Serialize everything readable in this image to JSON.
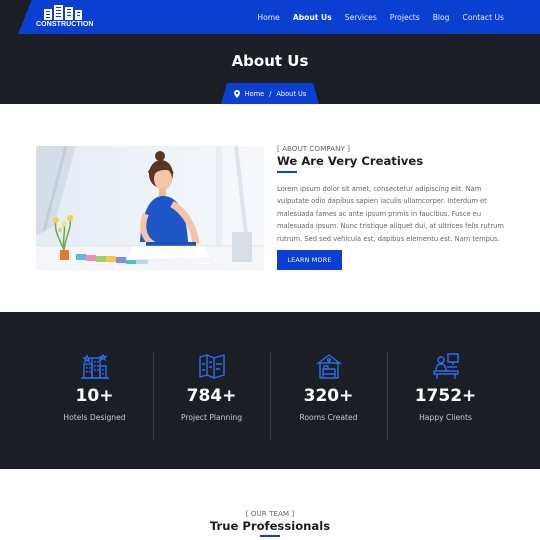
{
  "brand": {
    "name": "CONSTRUCTION"
  },
  "nav": {
    "items": [
      {
        "label": "Home"
      },
      {
        "label": "About Us"
      },
      {
        "label": "Services"
      },
      {
        "label": "Projects"
      },
      {
        "label": "Blog"
      },
      {
        "label": "Contact Us"
      }
    ],
    "active_index": 1
  },
  "banner": {
    "title": "About Us",
    "breadcrumb": {
      "home": "Home",
      "separator": "/",
      "current": "About Us"
    }
  },
  "about": {
    "kicker": "[ ABOUT COMPANY ]",
    "title": "We Are Very Creatives",
    "body": "Lorem ipsum dolor sit amet, consectetur adipiscing elit. Nam vulputate odio dapibus sapien iaculis ullamcorper. Interdum et malesuada fames ac ante ipsum primis in faucibus. Fusce eu malesuada ipsum. Nunc tristique aliquet dui, at ultrices felis rutrum rutrum. Sed sed vehicula est, dapibus elementu est. Nam tempus.",
    "button": "LEARN MORE"
  },
  "stats": [
    {
      "value": "10+",
      "label": "Hotels Designed",
      "icon": "city-buildings-icon"
    },
    {
      "value": "784+",
      "label": "Project Planning",
      "icon": "map-icon"
    },
    {
      "value": "320+",
      "label": "Rooms Created",
      "icon": "house-bed-icon"
    },
    {
      "value": "1752+",
      "label": "Happy Clients",
      "icon": "person-desk-icon"
    }
  ],
  "team": {
    "kicker": "[ OUR TEAM ]",
    "title": "True Professionals"
  },
  "colors": {
    "accent": "#0a3fd1",
    "dark": "#1b1e24"
  }
}
